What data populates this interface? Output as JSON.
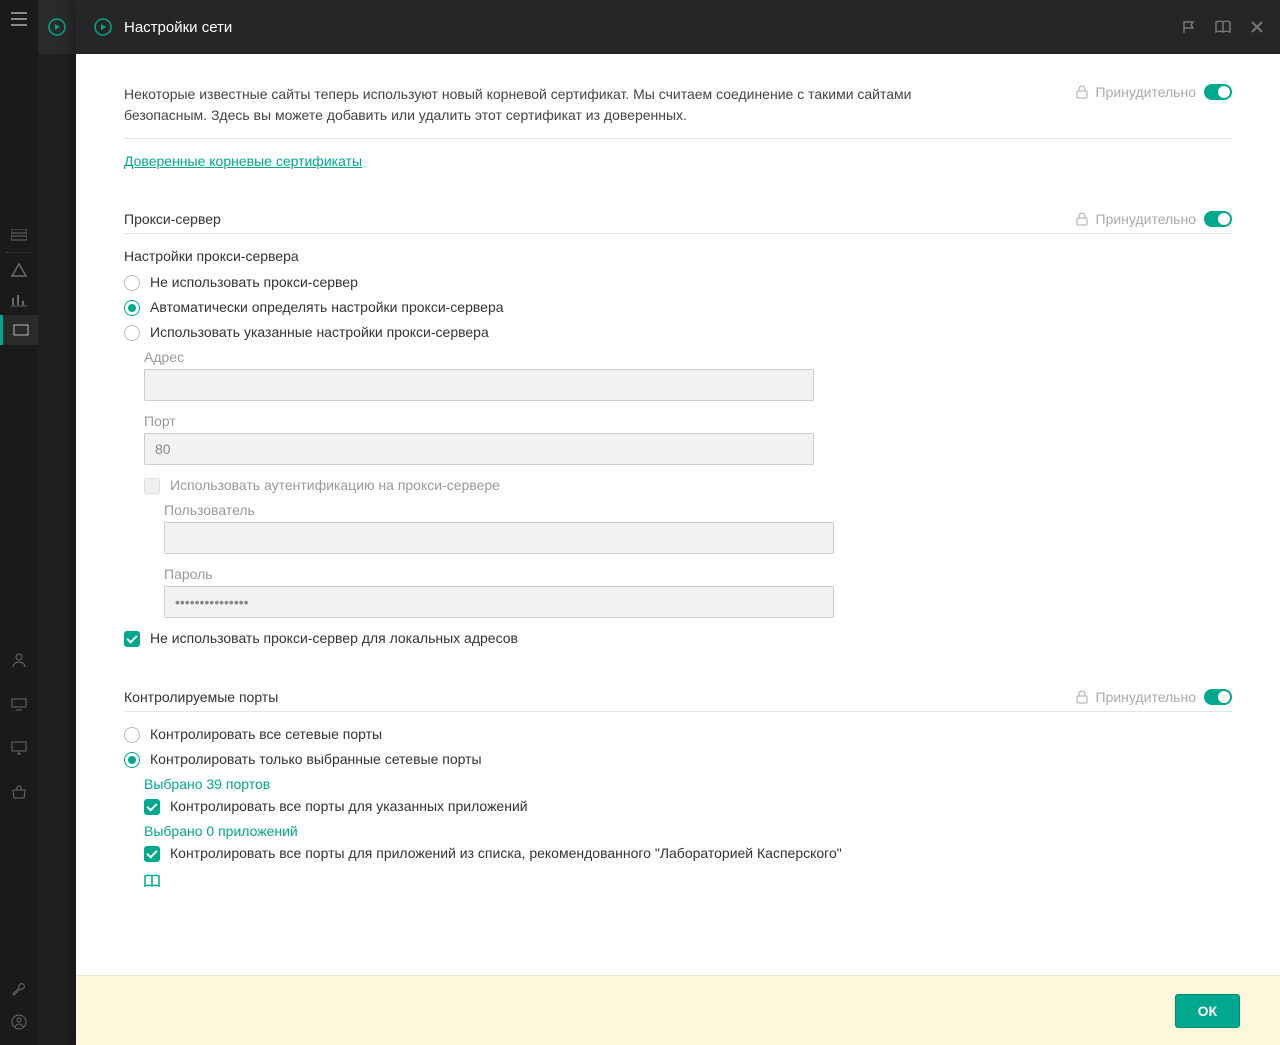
{
  "header": {
    "title": "Настройки сети"
  },
  "header_actions": {
    "flag": "flag-icon",
    "help": "book-icon",
    "close": "close-icon"
  },
  "cert_section": {
    "desc": "Некоторые известные сайты теперь используют новый корневой сертификат. Мы считаем соединение с такими сайтами безопасным. Здесь вы можете добавить или удалить этот сертификат из доверенных.",
    "forced_label": "Принудительно",
    "link": "Доверенные корневые сертификаты"
  },
  "proxy_section": {
    "title": "Прокси-сервер",
    "forced_label": "Принудительно",
    "settings_label": "Настройки прокси-сервера",
    "opt_none": "Не использовать прокси-сервер",
    "opt_auto": "Автоматически определять настройки прокси-сервера",
    "opt_manual": "Использовать указанные настройки прокси-сервера",
    "addr_label": "Адрес",
    "addr_value": "",
    "port_label": "Порт",
    "port_value": "80",
    "auth_label": "Использовать аутентификацию на прокси-сервере",
    "user_label": "Пользователь",
    "user_value": "",
    "pass_label": "Пароль",
    "pass_value": "•••••••••••••••",
    "bypass_local": "Не использовать прокси-сервер для локальных адресов"
  },
  "ports_section": {
    "title": "Контролируемые порты",
    "forced_label": "Принудительно",
    "opt_all": "Контролировать все сетевые порты",
    "opt_selected": "Контролировать только выбранные сетевые порты",
    "selected_ports": "Выбрано 39 портов",
    "check_apps": "Контролировать все порты для указанных приложений",
    "selected_apps": "Выбрано 0 приложений",
    "check_kasp": "Контролировать все порты для приложений из списка, рекомендованного \"Лабораторией Касперского\""
  },
  "footer": {
    "ok": "ОК"
  }
}
